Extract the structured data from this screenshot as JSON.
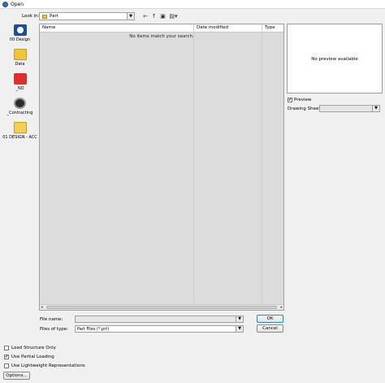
{
  "window": {
    "title": "Open"
  },
  "lookin": {
    "label": "Look in:",
    "value": "Part"
  },
  "toolbar": {
    "back": "←",
    "up": "↑",
    "new_folder": "▣",
    "views": "▤▾"
  },
  "places": [
    {
      "label": "00 Design",
      "icon": "design-icon"
    },
    {
      "label": "Data",
      "icon": "folder-icon"
    },
    {
      "label": "_ND",
      "icon": "app-icon"
    },
    {
      "label": "_Contracting",
      "icon": "gear-icon"
    },
    {
      "label": "01 DESIGN - ACC",
      "icon": "folder-icon"
    }
  ],
  "file_list": {
    "columns": [
      "Name",
      "Date modified",
      "Type"
    ],
    "empty_message": "No items match your search."
  },
  "preview": {
    "message": "No preview available",
    "checkbox_label": "Preview",
    "checked": true,
    "drawing_sheet_label": "Drawing Sheet"
  },
  "file_name": {
    "label": "File name:",
    "value": ""
  },
  "file_type": {
    "label": "Files of type:",
    "value": "Part Files (*.prt)"
  },
  "buttons": {
    "ok": "OK",
    "cancel": "Cancel",
    "options": "Options..."
  },
  "options": [
    {
      "label": "Load Structure Only",
      "checked": false
    },
    {
      "label": "Use Partial Loading",
      "checked": true
    },
    {
      "label": "Use Lightweight Representations",
      "checked": false
    }
  ]
}
